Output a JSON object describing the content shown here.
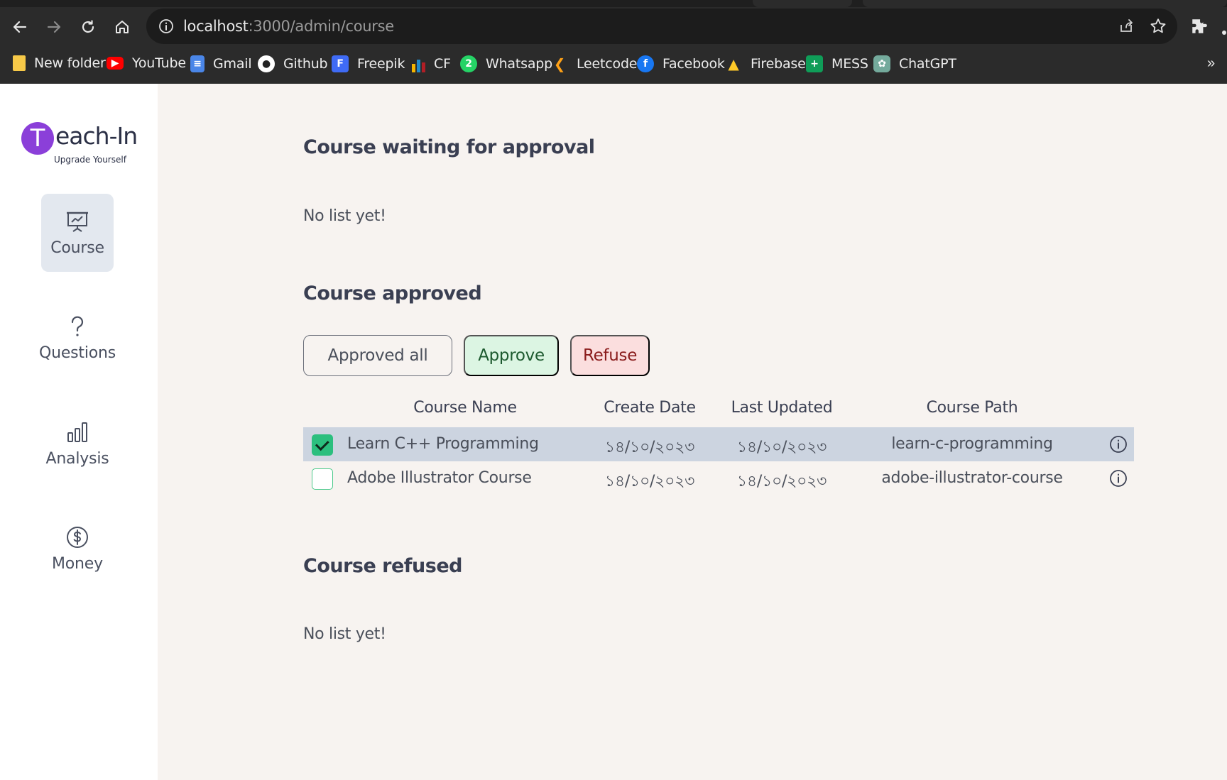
{
  "browser": {
    "url_host": "localhost",
    "url_path": ":3000/admin/course",
    "bookmarks": [
      {
        "label": "New folder",
        "color": "#f7c948"
      },
      {
        "label": "YouTube",
        "color": "#ff0000"
      },
      {
        "label": "Gmail",
        "color": "#4a86e8"
      },
      {
        "label": "Github",
        "color": "#ffffff"
      },
      {
        "label": "Freepik",
        "color": "#3f6bf5"
      },
      {
        "label": "CF",
        "color": "#f4b400"
      },
      {
        "label": "Whatsapp",
        "color": "#25d366"
      },
      {
        "label": "Leetcode",
        "color": "#ffa116"
      },
      {
        "label": "Facebook",
        "color": "#1877f2"
      },
      {
        "label": "Firebase",
        "color": "#ffca28"
      },
      {
        "label": "MESS",
        "color": "#0f9d58"
      },
      {
        "label": "ChatGPT",
        "color": "#74aa9c"
      }
    ],
    "more_bookmarks": "»"
  },
  "logo": {
    "letter": "T",
    "word": "each-In",
    "tagline": "Upgrade Yourself"
  },
  "sidebar": {
    "items": [
      {
        "label": "Course",
        "icon": "presentation-chart-icon",
        "active": true
      },
      {
        "label": "Questions",
        "icon": "question-icon",
        "active": false
      },
      {
        "label": "Analysis",
        "icon": "bar-chart-icon",
        "active": false
      },
      {
        "label": "Money",
        "icon": "dollar-circle-icon",
        "active": false
      }
    ]
  },
  "main": {
    "waiting": {
      "title": "Course waiting for approval",
      "empty": "No list yet!"
    },
    "approved": {
      "title": "Course approved",
      "buttons": {
        "approved_all": "Approved all",
        "approve": "Approve",
        "refuse": "Refuse"
      },
      "columns": [
        "Course Name",
        "Create Date",
        "Last Updated",
        "Course Path"
      ],
      "rows": [
        {
          "checked": true,
          "name": "Learn C++ Programming",
          "created": "১৪/১০/২০২৩",
          "updated": "১৪/১০/২০২৩",
          "path": "learn-c-programming"
        },
        {
          "checked": false,
          "name": "Adobe Illustrator Course",
          "created": "১৪/১০/২০২৩",
          "updated": "১৪/১০/২০২৩",
          "path": "adobe-illustrator-course"
        }
      ]
    },
    "refused": {
      "title": "Course refused",
      "empty": "No list yet!"
    }
  },
  "colors": {
    "accent_purple": "#8b3fd9",
    "approve_bg": "#dcf5e3",
    "refuse_bg": "#fbdede",
    "checkbox_green": "#2bbf7e",
    "selected_row": "#ccd4e0"
  }
}
